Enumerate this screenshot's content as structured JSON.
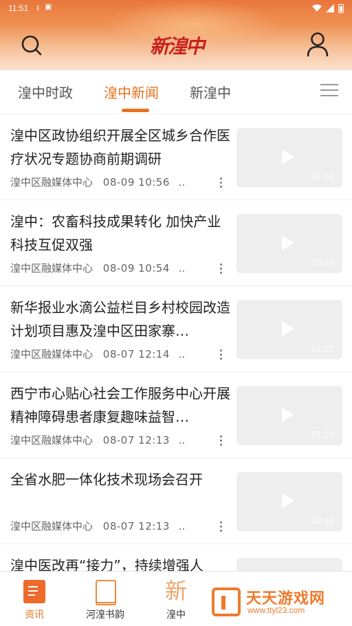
{
  "status_bar": {
    "time": "11:51",
    "left_icons": [
      "download-icon",
      "notification-icon"
    ],
    "right_icons": [
      "wifi-icon",
      "signal-icon",
      "battery-icon"
    ]
  },
  "header": {
    "logo_text": "新湟中",
    "colors": {
      "accent": "#e8721f",
      "logo": "#c8201e",
      "gradient_top": "#e9763c"
    }
  },
  "tabs": [
    {
      "label": "湟中时政",
      "active": false
    },
    {
      "label": "湟中新闻",
      "active": true
    },
    {
      "label": "新湟中",
      "active": false
    }
  ],
  "news": [
    {
      "title": "湟中区政协组织开展全区城乡合作医疗状况专题协商前期调研",
      "source": "湟中区融媒体中心",
      "time": "08-09 10:56",
      "ellipsis": "..",
      "duration": "01:53"
    },
    {
      "title": "湟中：农畜科技成果转化  加快产业科技互促双强",
      "source": "湟中区融媒体中心",
      "time": "08-09 10:54",
      "ellipsis": "..",
      "duration": "05:28"
    },
    {
      "title": "新华报业水滴公益栏目乡村校园改造计划项目惠及湟中区田家寨…",
      "source": "湟中区融媒体中心",
      "time": "08-07 12:14",
      "ellipsis": "..",
      "duration": "01:25"
    },
    {
      "title": "西宁市心贴心社会工作服务中心开展精神障碍患者康复趣味益智…",
      "source": "湟中区融媒体中心",
      "time": "08-07 12:13",
      "ellipsis": "..",
      "duration": "01:29"
    },
    {
      "title": "全省水肥一体化技术现场会召开",
      "source": "湟中区融媒体中心",
      "time": "08-07 12:13",
      "ellipsis": "..",
      "duration": "02:16"
    },
    {
      "title": "湟中医改再“接力”，持续增强人",
      "source": "",
      "time": "",
      "ellipsis": "",
      "duration": ""
    }
  ],
  "bottom_nav": [
    {
      "label": "资讯",
      "icon": "news-icon",
      "active": true
    },
    {
      "label": "河湟书韵",
      "icon": "book-icon",
      "active": false
    },
    {
      "label": "湟中",
      "icon": "xin-icon",
      "active": false,
      "icon_text": "新"
    }
  ],
  "watermark": {
    "title": "天天游戏网",
    "url": "www.ttyl23.com"
  }
}
